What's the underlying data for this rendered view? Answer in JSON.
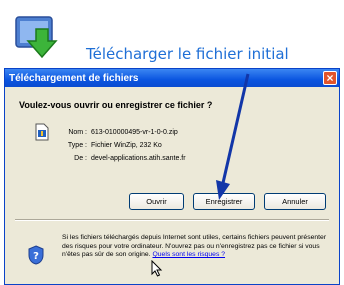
{
  "caption": "Télécharger le fichier initial",
  "dialog": {
    "title": "Téléchargement de fichiers",
    "question": "Voulez-vous ouvrir ou enregistrer ce fichier ?",
    "fields": {
      "name_label": "Nom :",
      "name_value": "613-010000495-vr-1-0-0.zip",
      "type_label": "Type :",
      "type_value": "Fichier WinZip, 232 Ko",
      "from_label": "De :",
      "from_value": "devel-applications.atih.sante.fr"
    },
    "buttons": {
      "open": "Ouvrir",
      "save": "Enregistrer",
      "cancel": "Annuler"
    },
    "warning_text": "Si les fichiers téléchargés depuis Internet sont utiles, certains fichiers peuvent présenter des risques pour votre ordinateur. N'ouvrez pas ou n'enregistrez pas ce fichier si vous n'êtes pas sûr de son origine.",
    "risks_link": "Quels sont les risques ?"
  },
  "colors": {
    "caption": "#1f6fd6",
    "titlebar": "#0b55e0",
    "dialog_bg": "#ece9d8",
    "arrow": "#1236a8"
  },
  "icons": [
    "download-app-icon",
    "file-icon",
    "close-icon",
    "shield-icon",
    "cursor-icon",
    "arrow"
  ]
}
